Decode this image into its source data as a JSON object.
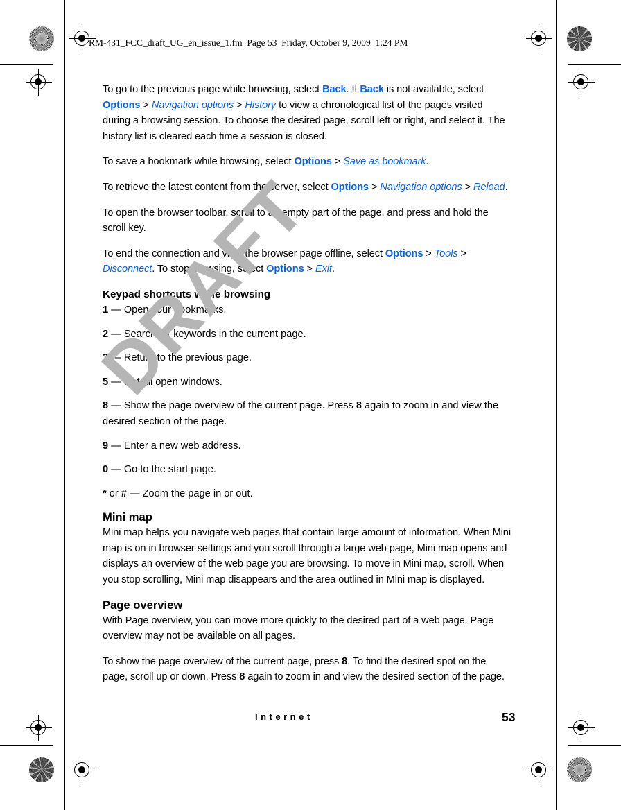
{
  "slug": {
    "text": "RM-431_FCC_draft_UG_en_issue_1.fm  Page 53  Friday, October 9, 2009  1:24 PM"
  },
  "watermark": {
    "text": "DRAFT",
    "color": "#b5b5b5"
  },
  "colors": {
    "ui_term_blue": "#0a62e8",
    "body_text": "#000000",
    "page_background": "#ffffff"
  },
  "body": {
    "paragraphs": [
      {
        "id": "previous-page",
        "runs": [
          {
            "type": "text",
            "text": "To go to the previous page while browsing, select "
          },
          {
            "type": "bold",
            "text": "Back"
          },
          {
            "type": "text",
            "text": ". If "
          },
          {
            "type": "bold",
            "text": "Back"
          },
          {
            "type": "text",
            "text": " is not available, select "
          },
          {
            "type": "bold",
            "text": "Options"
          },
          {
            "type": "sep",
            "text": " > "
          },
          {
            "type": "italic",
            "text": "Navigation options"
          },
          {
            "type": "sep",
            "text": " > "
          },
          {
            "type": "italic",
            "text": "History"
          },
          {
            "type": "text",
            "text": " to view a chronological list of the pages visited during a browsing session. To choose the desired page, scroll left or right, and select it. The history list is cleared each time a session is closed."
          }
        ]
      },
      {
        "id": "save-bookmark",
        "runs": [
          {
            "type": "text",
            "text": "To save a bookmark while browsing, select "
          },
          {
            "type": "bold",
            "text": "Options"
          },
          {
            "type": "sep",
            "text": " > "
          },
          {
            "type": "italic",
            "text": "Save as bookmark"
          },
          {
            "type": "text",
            "text": "."
          }
        ]
      },
      {
        "id": "reload-content",
        "runs": [
          {
            "type": "text",
            "text": "To retrieve the latest content from the server, select "
          },
          {
            "type": "bold",
            "text": "Options"
          },
          {
            "type": "sep",
            "text": " > "
          },
          {
            "type": "italic",
            "text": "Navigation options"
          },
          {
            "type": "sep",
            "text": " > "
          },
          {
            "type": "italic",
            "text": "Reload"
          },
          {
            "type": "text",
            "text": "."
          }
        ]
      },
      {
        "id": "browser-toolbar",
        "runs": [
          {
            "type": "text",
            "text": "To open the browser toolbar, scroll to an empty part of the page, and press and hold the scroll key."
          }
        ]
      },
      {
        "id": "end-connection",
        "runs": [
          {
            "type": "text",
            "text": "To end the connection and view the browser page offline, select "
          },
          {
            "type": "bold",
            "text": "Options"
          },
          {
            "type": "sep",
            "text": " > "
          },
          {
            "type": "italic",
            "text": "Tools"
          },
          {
            "type": "sep",
            "text": " > "
          },
          {
            "type": "italic",
            "text": "Disconnect"
          },
          {
            "type": "text",
            "text": ". To stop browsing, select "
          },
          {
            "type": "bold",
            "text": "Options"
          },
          {
            "type": "sep",
            "text": " > "
          },
          {
            "type": "italic",
            "text": "Exit"
          },
          {
            "type": "text",
            "text": "."
          }
        ]
      }
    ],
    "keypad_section": {
      "heading": "Keypad shortcuts while browsing",
      "shortcuts": [
        {
          "key": "1",
          "runs": [
            {
              "type": "key",
              "text": "1"
            },
            {
              "type": "text",
              "text": " — Open your bookmarks."
            }
          ]
        },
        {
          "key": "2",
          "runs": [
            {
              "type": "key",
              "text": "2"
            },
            {
              "type": "text",
              "text": " — Search for keywords in the current page."
            }
          ]
        },
        {
          "key": "3",
          "runs": [
            {
              "type": "key",
              "text": "3"
            },
            {
              "type": "text",
              "text": " — Return to the previous page."
            }
          ]
        },
        {
          "key": "5",
          "runs": [
            {
              "type": "key",
              "text": "5"
            },
            {
              "type": "text",
              "text": " — List all open windows."
            }
          ]
        },
        {
          "key": "8",
          "runs": [
            {
              "type": "key",
              "text": "8"
            },
            {
              "type": "text",
              "text": " — Show the page overview of the current page. Press "
            },
            {
              "type": "key",
              "text": "8"
            },
            {
              "type": "text",
              "text": " again to zoom in and view the desired section of the page."
            }
          ]
        },
        {
          "key": "9",
          "runs": [
            {
              "type": "key",
              "text": "9"
            },
            {
              "type": "text",
              "text": " — Enter a new web address."
            }
          ]
        },
        {
          "key": "0",
          "runs": [
            {
              "type": "key",
              "text": "0"
            },
            {
              "type": "text",
              "text": " — Go to the start page."
            }
          ]
        },
        {
          "key": "* or #",
          "runs": [
            {
              "type": "key",
              "text": "*"
            },
            {
              "type": "text",
              "text": " or "
            },
            {
              "type": "key",
              "text": "#"
            },
            {
              "type": "text",
              "text": " — Zoom the page in or out."
            }
          ]
        }
      ]
    },
    "sections": [
      {
        "id": "mini-map",
        "heading": "Mini map",
        "paragraphs": [
          {
            "id": "mini-map-body",
            "runs": [
              {
                "type": "text",
                "text": "Mini map helps you navigate web pages that contain large amount of information. When Mini map is on in browser settings and you scroll through a large web page, Mini map opens and displays an overview of the web page you are browsing. To move in Mini map, scroll. When you stop scrolling, Mini map disappears and the area outlined in Mini map is displayed."
              }
            ]
          }
        ]
      },
      {
        "id": "page-overview",
        "heading": "Page overview",
        "paragraphs": [
          {
            "id": "page-overview-body",
            "runs": [
              {
                "type": "text",
                "text": "With Page overview, you can move more quickly to the desired part of a web page. Page overview may not be available on all pages."
              }
            ]
          },
          {
            "id": "page-overview-usage",
            "runs": [
              {
                "type": "text",
                "text": "To show the page overview of the current page, press "
              },
              {
                "type": "key",
                "text": "8"
              },
              {
                "type": "text",
                "text": ". To find the desired spot on the page, scroll up or down. Press "
              },
              {
                "type": "key",
                "text": "8"
              },
              {
                "type": "text",
                "text": " again to zoom in and view the desired section of the page."
              }
            ]
          }
        ]
      }
    ]
  },
  "footer": {
    "section_name": "Internet",
    "page_number": "53"
  }
}
